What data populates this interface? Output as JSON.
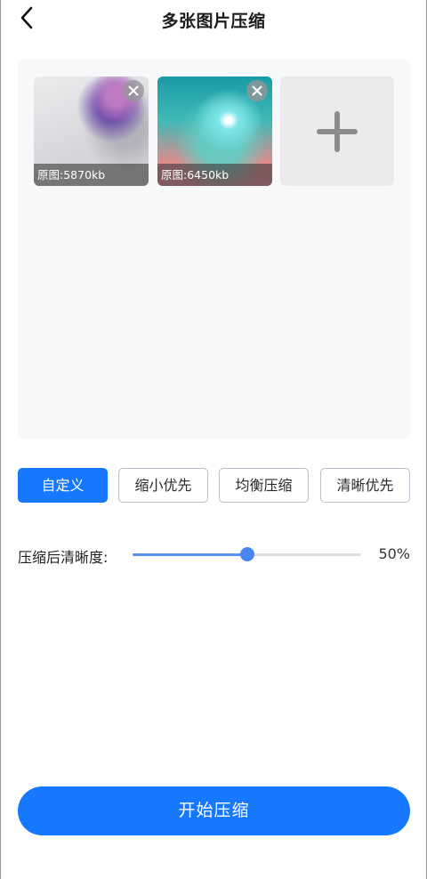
{
  "header": {
    "title": "多张图片压缩",
    "back_icon": "chevron-left-icon"
  },
  "images": [
    {
      "caption": "原图:5870kb",
      "remove_icon": "close-icon"
    },
    {
      "caption": "原图:6450kb",
      "remove_icon": "close-icon"
    }
  ],
  "add_tile": {
    "icon": "plus-icon"
  },
  "presets": [
    {
      "label": "自定义",
      "selected": true
    },
    {
      "label": "缩小优先",
      "selected": false
    },
    {
      "label": "均衡压缩",
      "selected": false
    },
    {
      "label": "清晰优先",
      "selected": false
    }
  ],
  "clarity": {
    "label": "压缩后清晰度:",
    "value_text": "50%",
    "value_percent": 50
  },
  "start_button": {
    "label": "开始压缩"
  },
  "colors": {
    "accent": "#1677ff",
    "slider_fill": "#5b8ff0",
    "panel_bg": "#f7f8fa",
    "add_tile_bg": "#ebebed"
  }
}
